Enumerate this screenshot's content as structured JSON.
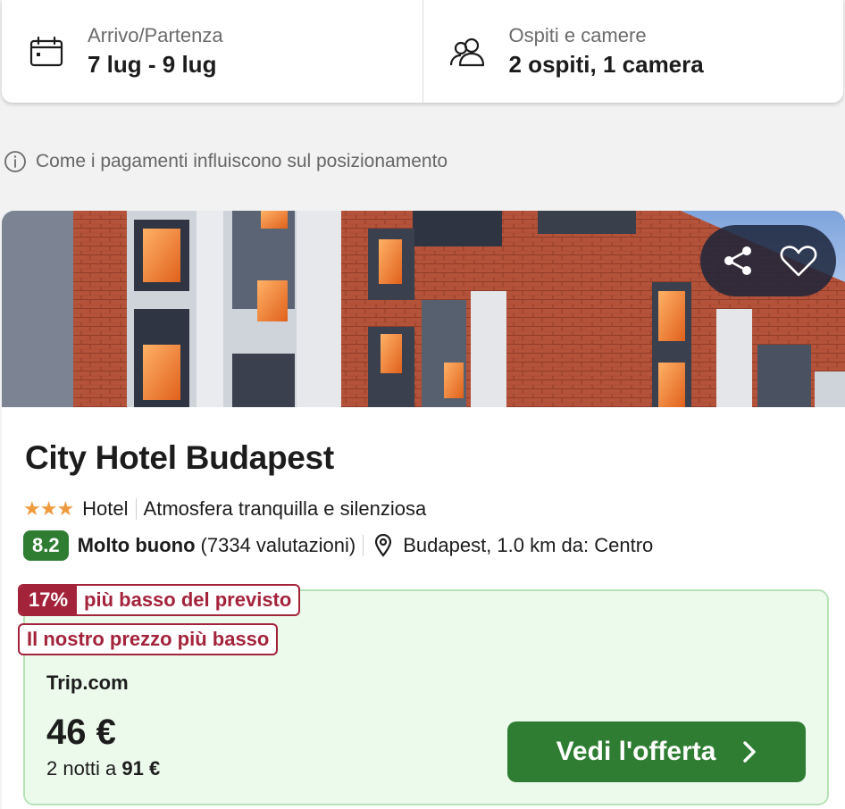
{
  "search": {
    "dates": {
      "label": "Arrivo/Partenza",
      "value": "7 lug - 9 lug",
      "icon": "calendar-icon"
    },
    "guests": {
      "label": "Ospiti e camere",
      "value": "2 ospiti, 1 camera",
      "icon": "people-icon"
    }
  },
  "ranking_note": {
    "text": "Come i pagamenti influiscono sul posizionamento",
    "icon": "info-icon"
  },
  "hotel": {
    "name": "City Hotel Budapest",
    "stars": "★★★",
    "star_count": 3,
    "type": "Hotel",
    "tagline": "Atmosfera tranquilla e silenziosa",
    "rating": "8.2",
    "rating_label": "Molto buono",
    "rating_count": "(7334 valutazioni)",
    "location": "Budapest, 1.0 km da: Centro",
    "actions": {
      "share_icon": "share-icon",
      "favorite_icon": "heart-icon"
    }
  },
  "deal": {
    "discount_pct": "17%",
    "discount_text": "più basso del previsto",
    "best_price": "Il nostro prezzo più basso",
    "provider": "Trip.com",
    "price": "46 €",
    "total_prefix": "2 notti a",
    "total_value": "91 €",
    "cta_label": "Vedi l'offerta"
  },
  "colors": {
    "accent_green": "#2f7d32",
    "deal_background": "#ecfaec",
    "deal_red": "#a3233a",
    "star_orange": "#f09a3e"
  }
}
